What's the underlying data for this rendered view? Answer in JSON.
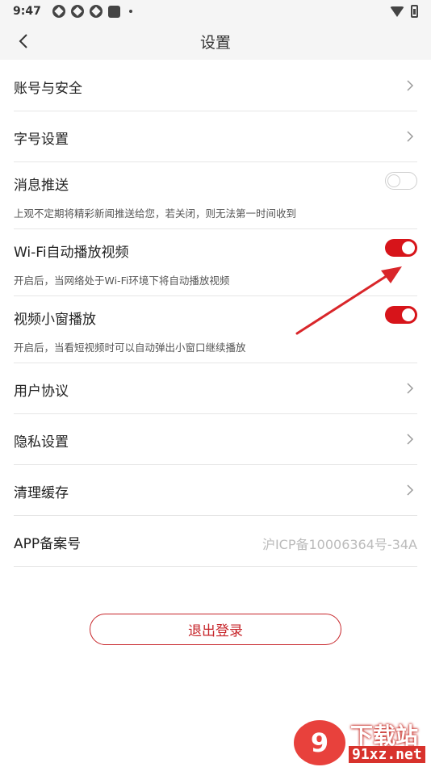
{
  "status_bar": {
    "time": "9:47"
  },
  "nav": {
    "title": "设置"
  },
  "settings": {
    "account": {
      "label": "账号与安全"
    },
    "font_size": {
      "label": "字号设置"
    },
    "push": {
      "label": "消息推送",
      "desc": "上观不定期将精彩新闻推送给您，若关闭，则无法第一时间收到",
      "enabled": false
    },
    "wifi_autoplay": {
      "label": "Wi-Fi自动播放视频",
      "desc": "开启后，当网络处于Wi-Fi环境下将自动播放视频",
      "enabled": true
    },
    "mini_window": {
      "label": "视频小窗播放",
      "desc": "开启后，当看短视频时可以自动弹出小窗口继续播放",
      "enabled": true
    },
    "user_agreement": {
      "label": "用户协议"
    },
    "privacy": {
      "label": "隐私设置"
    },
    "clear_cache": {
      "label": "清理缓存"
    },
    "app_record": {
      "label": "APP备案号",
      "value": "沪ICP备10006364号-34A"
    }
  },
  "logout": {
    "label": "退出登录"
  },
  "colors": {
    "accent": "#d7141a",
    "arrow": "#d9262a"
  },
  "watermark": {
    "logo_text": "9",
    "title": "下载站",
    "url": "91xz.net"
  }
}
